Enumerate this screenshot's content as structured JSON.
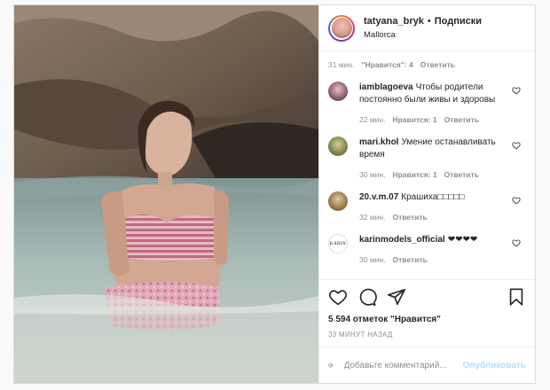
{
  "post": {
    "username": "tatyana_bryk",
    "separator": "•",
    "follow_label": "Подписки",
    "location": "Mallorca"
  },
  "caption_meta": {
    "time": "31 мин.",
    "likes": "\"Нравится\": 4",
    "reply": "Ответить"
  },
  "comments": [
    {
      "user": "iamblagoeva",
      "text": "Чтобы родители постоянно были живы и здоровы",
      "time": "22 мин.",
      "likes": "Нравится: 1",
      "reply": "Ответить",
      "avatar_color": "#7a4a6a"
    },
    {
      "user": "mari.khol",
      "text": "Умение останавливать время",
      "time": "30 мин.",
      "likes": "Нравится: 1",
      "reply": "Ответить",
      "avatar_color": "#6b7a3a"
    },
    {
      "user": "20.v.m.07",
      "text": "Крашиха□□□□□",
      "time": "32 мин.",
      "likes": "",
      "reply": "Ответить",
      "avatar_color": "#8a6a3a"
    },
    {
      "user": "karinmodels_official",
      "text": "❤❤❤❤",
      "time": "30 мин.",
      "likes": "",
      "reply": "Ответить",
      "avatar_color": "#ffffff",
      "avatar_text": "KARIN"
    }
  ],
  "actions": {
    "like_count": "5 594 отметок \"Нравится\"",
    "posted_time": "33 МИНУТ НАЗАД"
  },
  "add_comment": {
    "placeholder": "Добавьте комментарий...",
    "publish_label": "Опубликовать"
  }
}
